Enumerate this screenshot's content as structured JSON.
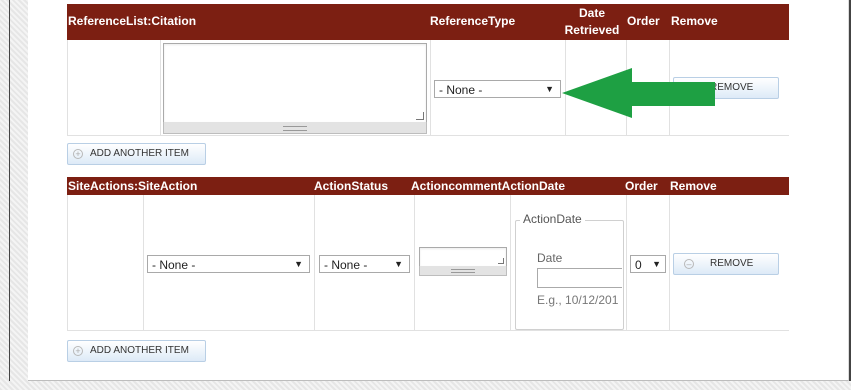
{
  "reference_list": {
    "headers": {
      "citation": "ReferenceList:Citation",
      "reference_type": "ReferenceType",
      "date_retrieved": "Date Retrieved",
      "order": "Order",
      "remove": "Remove"
    },
    "row": {
      "reference_type_value": "- None -",
      "remove_label": "REMOVE"
    },
    "add_label": "ADD ANOTHER ITEM"
  },
  "site_actions": {
    "headers": {
      "site_action": "SiteActions:SiteAction",
      "action_status": "ActionStatus",
      "action_comment": "ActioncommentActionDate",
      "order": "Order",
      "remove": "Remove"
    },
    "row": {
      "site_action_value": "- None -",
      "action_status_value": "- None -",
      "action_date_legend": "ActionDate",
      "date_label": "Date",
      "date_hint": "E.g., 10/12/201",
      "order_value": "0",
      "remove_label": "REMOVE"
    },
    "add_label": "ADD ANOTHER ITEM"
  },
  "annotation": {
    "arrow_color": "#1ea043"
  },
  "colors": {
    "header_bg": "#7c1f12",
    "button_bg": "#ddeaf7"
  }
}
